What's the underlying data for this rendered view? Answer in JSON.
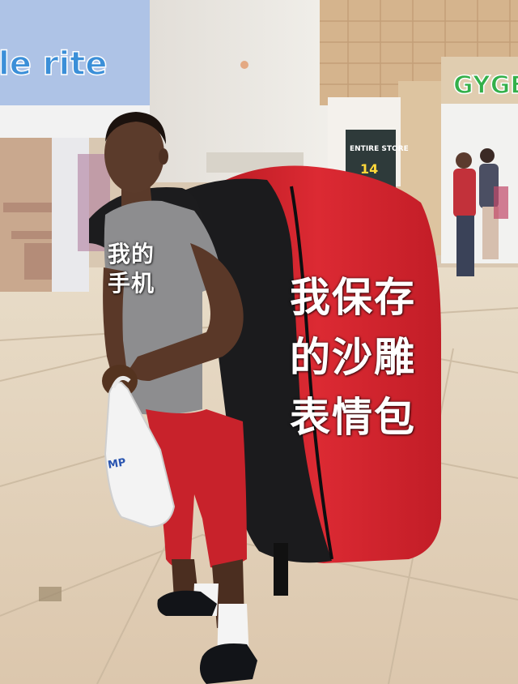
{
  "scene": {
    "store_sign_left": "le rite",
    "store_sign_right": "GYGEO",
    "poster_line": "ENTIRE STORE",
    "poster_number": "14",
    "shopping_bag_print": "MP",
    "colors": {
      "backpack_red": "#d8242f",
      "backpack_black": "#1b1b1d",
      "shirt_gray": "#8d8d8f",
      "shorts_red": "#c8222b",
      "floor_tile": "#e6d6bf",
      "wall": "#e9e6e1",
      "sign_band": "#b6c9e8"
    }
  },
  "captions": {
    "phone_label": "我的\n手机",
    "meme_label": "我保存\n的沙雕\n表情包"
  }
}
